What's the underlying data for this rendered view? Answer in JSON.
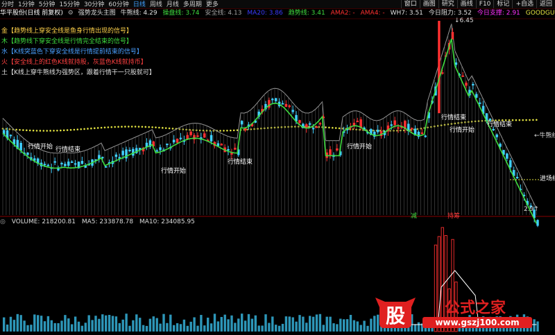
{
  "toolbar": {
    "periods": [
      "分时",
      "1分钟",
      "5分钟",
      "15分钟",
      "30分钟",
      "60分钟",
      "日线",
      "周线",
      "月线",
      "多周期",
      "更多"
    ],
    "active_period": "日线",
    "right_buttons": [
      "窗口",
      "画图",
      "研究",
      "画线",
      "F10",
      "标记",
      "+自选",
      "返回"
    ]
  },
  "infobar": {
    "stock": "华平股份(日线 前复权)",
    "indicator": "强势龙头主图",
    "items": [
      {
        "text": "牛熊线: 4.29",
        "color": "#e0e0e0"
      },
      {
        "text": "操盘线: 3.74",
        "color": "#3fdc3f"
      },
      {
        "text": "安全线: 4.13",
        "color": "#a0a0a0"
      },
      {
        "text": "MA20: 3.86",
        "color": "#3a3aff"
      },
      {
        "text": "趋势线: 3.41",
        "color": "#3fdc3f"
      },
      {
        "text": "AMA2: -",
        "color": "#ff3030"
      },
      {
        "text": "AMA4: -",
        "color": "#ff3030"
      },
      {
        "text": "WH7: 3.51",
        "color": "#e0e0e0"
      },
      {
        "text": "今日阻力: 3.52",
        "color": "#e0e0e0"
      },
      {
        "text": "今日支撑: 2.91",
        "color": "#ff30ff"
      },
      {
        "text": "GOODGUPIAO: -",
        "color": "#e0e040"
      }
    ]
  },
  "legend": [
    {
      "text": "金【趋势线上穿安全线是鱼身行情出现的信号】",
      "color": "#ffd24a"
    },
    {
      "text": "木【趋势线下穿安全线是行情完全结束的信号】",
      "color": "#3fdc3f"
    },
    {
      "text": "水【K线突蓝色下穿安全线是行情提前结束的信号】",
      "color": "#4aa0ff"
    },
    {
      "text": "火【安全线上的红色K线就持股，灰蓝色K线就持币】",
      "color": "#ff4040"
    },
    {
      "text": "土【K线上穿牛熊线为强势区，跟着行情干一只股就可】",
      "color": "#e0e0e0"
    }
  ],
  "annotations": {
    "start_label": "行情开始",
    "end_label": "行情结束",
    "bull_label": "牛熊线",
    "entry_label": "进场线",
    "high_price": "6.45",
    "low_price": "2.91",
    "sub_marks": [
      "减",
      "持筹"
    ]
  },
  "volume": {
    "label": "VOLUME: 218200.81",
    "ma5": "MA5: 233878.78",
    "ma10": "MA10: 234085.95"
  },
  "logo": {
    "main": "公式之家",
    "url": "www.gszj100.com",
    "badge": "股"
  },
  "colors": {
    "up": "#ff3030",
    "down": "#3fd0ff",
    "bg": "#000000",
    "bull": "#e0e040"
  }
}
